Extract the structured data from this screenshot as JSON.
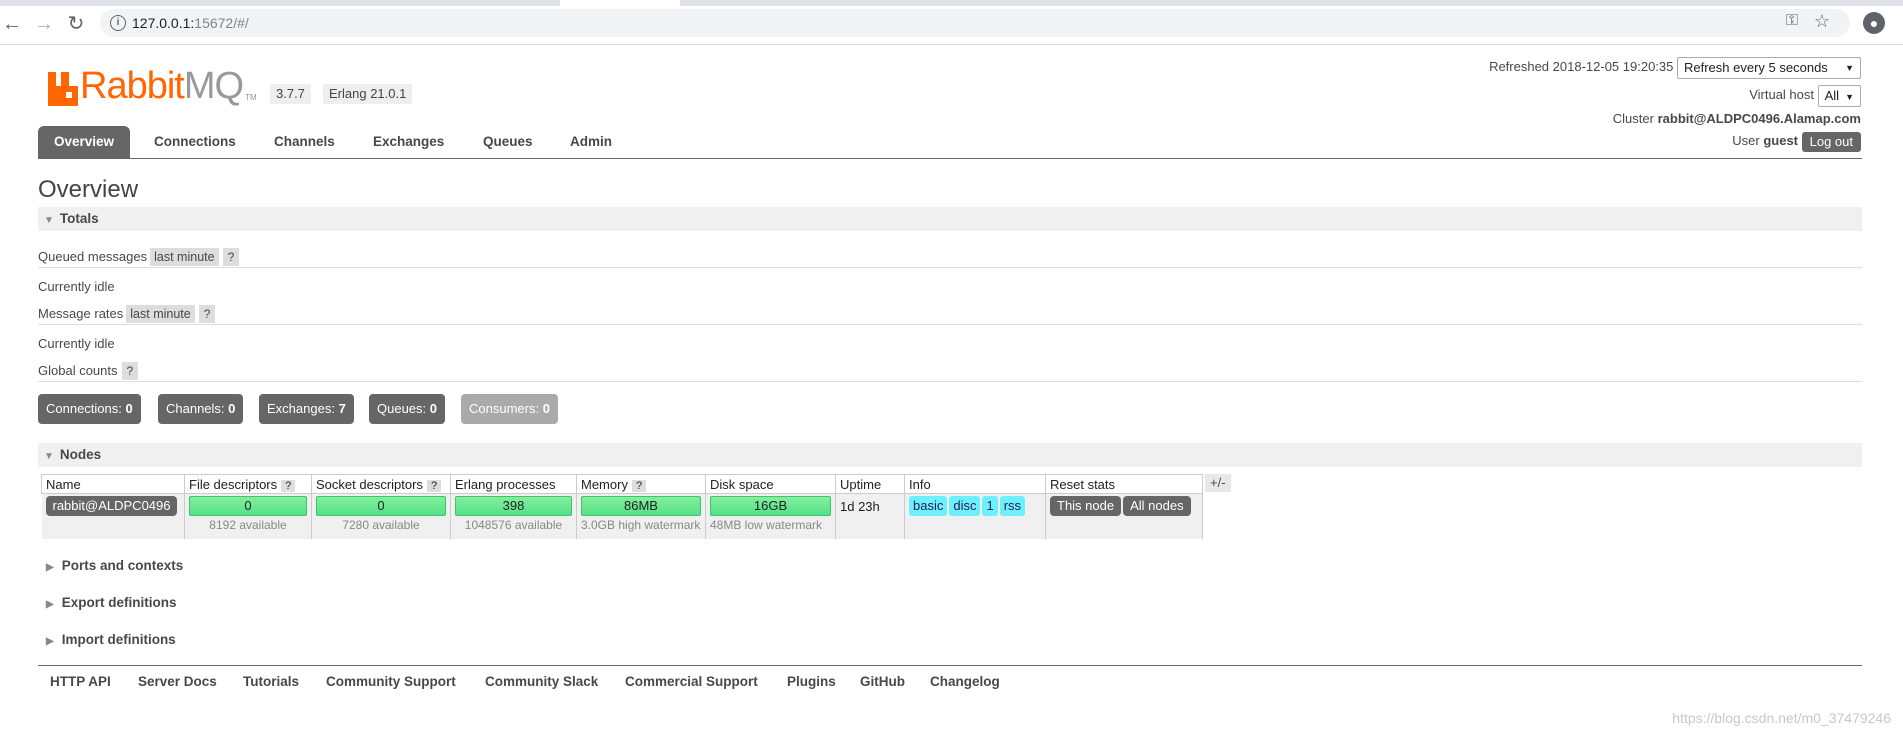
{
  "browser": {
    "url_host": "127.0.0.1:",
    "url_rest": "15672/#/"
  },
  "header": {
    "logo_text_rabbit": "Rabbit",
    "logo_text_mq": "MQ",
    "logo_tm": "TM",
    "version": "3.7.7",
    "erlang": "Erlang 21.0.1",
    "refreshed_label": "Refreshed 2018-12-05 19:20:35",
    "refresh_select": "Refresh every 5 seconds",
    "vhost_label": "Virtual host",
    "vhost_value": "All",
    "cluster_label": "Cluster",
    "cluster_value": "rabbit@ALDPC0496.Alamap.com",
    "user_label": "User",
    "user_value": "guest",
    "logout_label": "Log out"
  },
  "tabs": [
    {
      "label": "Overview",
      "active": true
    },
    {
      "label": "Connections"
    },
    {
      "label": "Channels"
    },
    {
      "label": "Exchanges"
    },
    {
      "label": "Queues"
    },
    {
      "label": "Admin"
    }
  ],
  "page_title": "Overview",
  "totals": {
    "title": "Totals",
    "queued_label": "Queued messages",
    "queued_period": "last minute",
    "help": "?",
    "queued_status": "Currently idle",
    "rates_label": "Message rates",
    "rates_period": "last minute",
    "rates_status": "Currently idle",
    "global_label": "Global counts"
  },
  "counts": [
    {
      "label": "Connections:",
      "value": "0"
    },
    {
      "label": "Channels:",
      "value": "0"
    },
    {
      "label": "Exchanges:",
      "value": "7"
    },
    {
      "label": "Queues:",
      "value": "0"
    },
    {
      "label": "Consumers:",
      "value": "0"
    }
  ],
  "nodes": {
    "title": "Nodes",
    "headers": [
      "Name",
      "File descriptors",
      "Socket descriptors",
      "Erlang processes",
      "Memory",
      "Disk space",
      "Uptime",
      "Info",
      "Reset stats"
    ],
    "plusminus": "+/-",
    "row": {
      "name": "rabbit@ALDPC0496",
      "fd": "0",
      "fd_avail": "8192 available",
      "sd": "0",
      "sd_avail": "7280 available",
      "ep": "398",
      "ep_avail": "1048576 available",
      "mem": "86MB",
      "mem_wm": "3.0GB high watermark",
      "disk": "16GB",
      "disk_wm": "48MB low watermark",
      "uptime": "1d 23h",
      "info": [
        "basic",
        "disc",
        "1",
        "rss"
      ],
      "reset": [
        "This node",
        "All nodes"
      ]
    }
  },
  "collapsed_sections": [
    "Ports and contexts",
    "Export definitions",
    "Import definitions"
  ],
  "footer_links": [
    "HTTP API",
    "Server Docs",
    "Tutorials",
    "Community Support",
    "Community Slack",
    "Commercial Support",
    "Plugins",
    "GitHub",
    "Changelog"
  ],
  "watermark": "https://blog.csdn.net/m0_37479246"
}
